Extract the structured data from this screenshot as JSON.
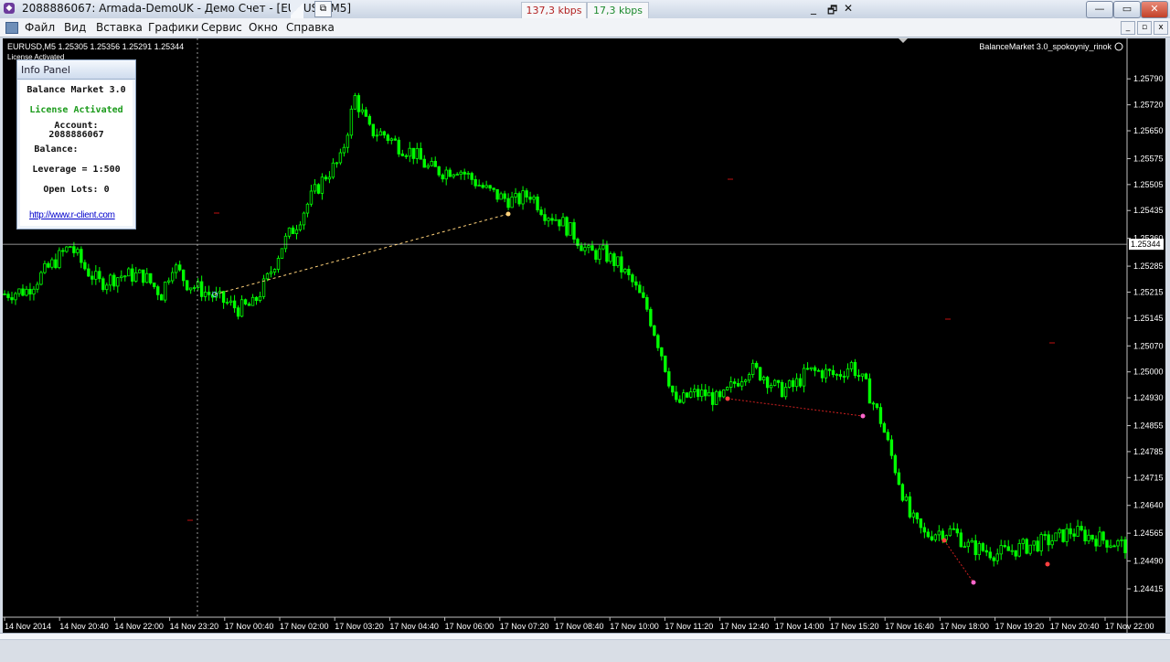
{
  "window": {
    "title": "2088886067: Armada-DemoUK - Демо Счет - [EURUSD,M5]",
    "kbps_in": "137,3 kbps",
    "kbps_out": "17,3 kbps",
    "inner_minimize": "_",
    "inner_restore": "🗗",
    "inner_close": "✕",
    "minimize": "—",
    "restore": "▭",
    "close": "✕"
  },
  "menu": {
    "items": [
      "Файл",
      "Вид",
      "Вставка",
      "Графики",
      "Сервис",
      "Окно",
      "Справка"
    ]
  },
  "chart": {
    "header": "EURUSD,M5  1.25305 1.25356 1.25291 1.25344",
    "license_small": "License Activated",
    "indicator_label": "BalanceMarket 3.0_spokoyniy_rinok",
    "current_price": "1.25344",
    "colors": {
      "bull": "#00ff00",
      "bear": "#00ff00",
      "bg": "#000000",
      "price_line": "#c0c0c0"
    }
  },
  "chart_data": {
    "type": "line",
    "title": "EURUSD,M5",
    "xlabel": "",
    "ylabel": "",
    "ylim": [
      1.24415,
      1.2583
    ],
    "x_ticks": [
      "14 Nov 2014",
      "14 Nov 20:40",
      "14 Nov 22:00",
      "14 Nov 23:20",
      "17 Nov 00:40",
      "17 Nov 02:00",
      "17 Nov 03:20",
      "17 Nov 04:40",
      "17 Nov 06:00",
      "17 Nov 07:20",
      "17 Nov 08:40",
      "17 Nov 10:00",
      "17 Nov 11:20",
      "17 Nov 12:40",
      "17 Nov 14:00",
      "17 Nov 15:20",
      "17 Nov 16:40",
      "17 Nov 18:00",
      "17 Nov 19:20",
      "17 Nov 20:40",
      "17 Nov 22:00"
    ],
    "y_ticks": [
      "1.25790",
      "1.25720",
      "1.25650",
      "1.25575",
      "1.25505",
      "1.25435",
      "1.25360",
      "1.25285",
      "1.25215",
      "1.25145",
      "1.25070",
      "1.25000",
      "1.24930",
      "1.24855",
      "1.24785",
      "1.24715",
      "1.24640",
      "1.24565",
      "1.24490",
      "1.24415"
    ],
    "series": [
      {
        "values": [
          [
            0,
            1.2521
          ],
          [
            6,
            1.2522
          ],
          [
            12,
            1.2528
          ],
          [
            18,
            1.2534
          ],
          [
            22,
            1.2528
          ],
          [
            26,
            1.2524
          ],
          [
            32,
            1.2526
          ],
          [
            38,
            1.2526
          ],
          [
            43,
            1.2521
          ],
          [
            46,
            1.2529
          ],
          [
            50,
            1.2524
          ],
          [
            56,
            1.2521
          ],
          [
            60,
            1.2519
          ],
          [
            64,
            1.2517
          ],
          [
            68,
            1.2518
          ],
          [
            72,
            1.2525
          ],
          [
            76,
            1.2534
          ],
          [
            80,
            1.254
          ],
          [
            84,
            1.2547
          ],
          [
            88,
            1.2553
          ],
          [
            92,
            1.2557
          ],
          [
            96,
            1.2574
          ],
          [
            100,
            1.2565
          ],
          [
            104,
            1.2564
          ],
          [
            108,
            1.2561
          ],
          [
            112,
            1.2559
          ],
          [
            116,
            1.2555
          ],
          [
            120,
            1.2554
          ],
          [
            124,
            1.2555
          ],
          [
            128,
            1.2552
          ],
          [
            132,
            1.2549
          ],
          [
            136,
            1.2547
          ],
          [
            140,
            1.2546
          ],
          [
            144,
            1.2548
          ],
          [
            148,
            1.2543
          ],
          [
            152,
            1.2541
          ],
          [
            156,
            1.2537
          ],
          [
            160,
            1.2532
          ],
          [
            164,
            1.2532
          ],
          [
            168,
            1.2529
          ],
          [
            172,
            1.2524
          ],
          [
            176,
            1.2517
          ],
          [
            180,
            1.2505
          ],
          [
            184,
            1.2491
          ],
          [
            188,
            1.2494
          ],
          [
            192,
            1.2494
          ],
          [
            196,
            1.2492
          ],
          [
            200,
            1.2497
          ],
          [
            204,
            1.2501
          ],
          [
            208,
            1.2499
          ],
          [
            212,
            1.2495
          ],
          [
            216,
            1.2496
          ],
          [
            220,
            1.25
          ],
          [
            224,
            1.25
          ],
          [
            228,
            1.2499
          ],
          [
            232,
            1.2502
          ],
          [
            236,
            1.2496
          ],
          [
            240,
            1.2487
          ],
          [
            244,
            1.2474
          ],
          [
            248,
            1.2461
          ],
          [
            252,
            1.2456
          ],
          [
            256,
            1.2457
          ],
          [
            260,
            1.2457
          ],
          [
            264,
            1.2453
          ],
          [
            268,
            1.2452
          ],
          [
            272,
            1.2451
          ],
          [
            276,
            1.2452
          ],
          [
            280,
            1.2453
          ],
          [
            284,
            1.2454
          ],
          [
            288,
            1.2455
          ],
          [
            292,
            1.2457
          ],
          [
            296,
            1.2456
          ],
          [
            300,
            1.2455
          ],
          [
            304,
            1.2454
          ],
          [
            307,
            1.2453
          ]
        ]
      }
    ],
    "current_price": 1.25344,
    "grid": false,
    "legend": "none"
  },
  "info_panel": {
    "title": "Info Panel",
    "product": "Balance Market 3.0",
    "license": "License Activated",
    "account_label": "Account:",
    "account_number": "2088886067",
    "balance_label": "Balance:",
    "leverage": "Leverage = 1:500",
    "open_lots": "Open Lots: 0",
    "link": "http://www.r-client.com",
    "license_color": "#1a9a1a"
  }
}
